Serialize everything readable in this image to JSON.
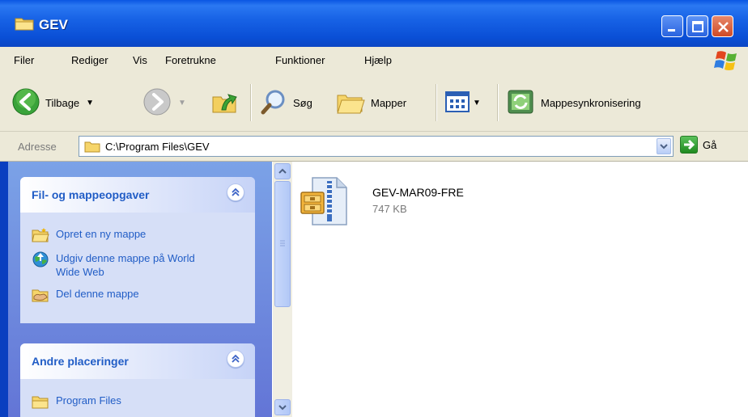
{
  "window": {
    "title": "GEV"
  },
  "menu": {
    "items": [
      "Filer",
      "Rediger",
      "Vis",
      "Foretrukne",
      "Funktioner",
      "Hjælp"
    ]
  },
  "toolbar": {
    "back_label": "Tilbage",
    "search_label": "Søg",
    "folders_label": "Mapper",
    "sync_label": "Mappesynkronisering"
  },
  "address": {
    "label": "Adresse",
    "value": "C:\\Program Files\\GEV",
    "go_label": "Gå"
  },
  "sidebar": {
    "tasks": {
      "title": "Fil- og mappeopgaver",
      "items": [
        {
          "label": "Opret en ny mappe",
          "icon": "new-folder-icon"
        },
        {
          "label": "Udgiv denne mappe på World Wide Web",
          "icon": "publish-web-icon"
        },
        {
          "label": "Del denne mappe",
          "icon": "share-folder-icon"
        }
      ]
    },
    "places": {
      "title": "Andre placeringer",
      "items": [
        {
          "label": "Program Files",
          "icon": "folder-icon"
        }
      ]
    }
  },
  "files": [
    {
      "name": "GEV-MAR09-FRE",
      "size": "747 KB",
      "icon": "zip-archive-icon"
    }
  ],
  "colors": {
    "titlebar": "#0a55e3",
    "sidebar_link": "#215dc6",
    "panel_bg": "#d6dff7",
    "chrome": "#ece9d8"
  }
}
